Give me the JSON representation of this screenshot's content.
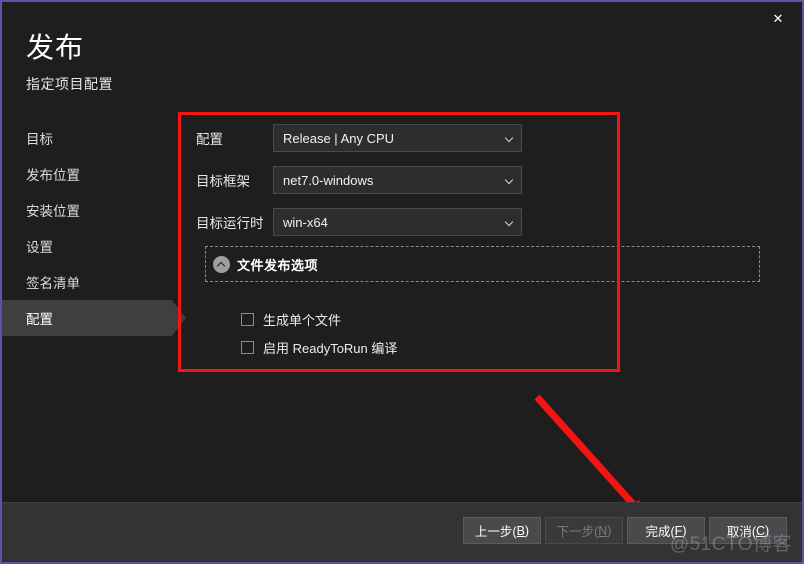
{
  "window": {
    "title": "发布",
    "subtitle": "指定项目配置",
    "close_label": "✕",
    "accent_red": "#f41414",
    "bg": "#1e1e1e",
    "footer_bg": "#333335",
    "border": "#5b53a8"
  },
  "sidebar": {
    "items": [
      {
        "label": "目标",
        "selected": false
      },
      {
        "label": "发布位置",
        "selected": false
      },
      {
        "label": "安装位置",
        "selected": false
      },
      {
        "label": "设置",
        "selected": false
      },
      {
        "label": "签名清单",
        "selected": false
      },
      {
        "label": "配置",
        "selected": true
      }
    ]
  },
  "form": {
    "fields": [
      {
        "label": "配置",
        "value": "Release | Any CPU",
        "icon": "chevron-down-icon"
      },
      {
        "label": "目标框架",
        "value": "net7.0-windows",
        "icon": "chevron-down-icon"
      },
      {
        "label": "目标运行时",
        "value": "win-x64",
        "icon": "chevron-down-icon"
      }
    ]
  },
  "groupbox": {
    "title": "文件发布选项",
    "collapse_icon": "chevron-up-circle-icon",
    "expanded": true,
    "options": [
      {
        "label": "生成单个文件",
        "checked": false
      },
      {
        "label": "启用 ReadyToRun 编译",
        "checked": false
      }
    ]
  },
  "footer": {
    "buttons": [
      {
        "label": "上一步(B)",
        "text": "上一步(",
        "mnemonic": "B",
        "tail": ")",
        "disabled": false
      },
      {
        "label": "下一步(N)",
        "text": "下一步(",
        "mnemonic": "N",
        "tail": ")",
        "disabled": true
      },
      {
        "label": "完成(F)",
        "text": "完成(",
        "mnemonic": "F",
        "tail": ")",
        "disabled": false
      },
      {
        "label": "取消(C)",
        "text": "取消(",
        "mnemonic": "C",
        "tail": ")",
        "disabled": false
      }
    ]
  },
  "annotations": {
    "rect": {
      "color": "#f41414"
    },
    "arrow": {
      "color": "#f41414",
      "points_to": "完成(F)"
    }
  },
  "watermark": {
    "text": "@51CTO博客"
  }
}
